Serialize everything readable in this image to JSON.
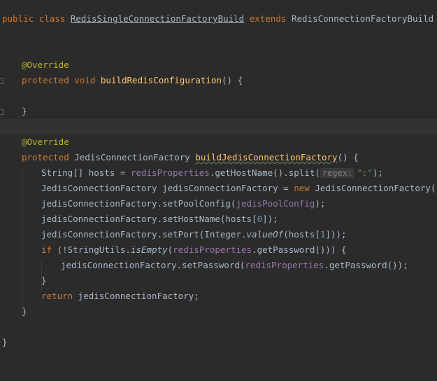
{
  "code": {
    "l1": {
      "kw1": "public",
      "kw2": "class",
      "cls": "RedisSingleConnectionFactoryBuild",
      "kw3": "extends",
      "parent": "RedisConnectionFactoryBuild",
      "brace": "{"
    },
    "l4": {
      "ann": "@Override"
    },
    "l5": {
      "kw1": "protected",
      "kw2": "void",
      "fn": "buildRedisConfiguration",
      "rest": "() {"
    },
    "l7": {
      "brace": "}"
    },
    "l9": {
      "ann": "@Override"
    },
    "l10": {
      "kw1": "protected",
      "type": "JedisConnectionFactory",
      "fn": "buildJedisConnectionFactory",
      "rest": "() {"
    },
    "l11": {
      "a": "String[] hosts = ",
      "field": "redisProperties",
      "b": ".getHostName().split(",
      "hint": "regex:",
      "str": "\":\"",
      "c": ");"
    },
    "l12": {
      "a": "JedisConnectionFactory jedisConnectionFactory = ",
      "kw": "new",
      "b": " JedisConnectionFactory();"
    },
    "l13": {
      "a": "jedisConnectionFactory.setPoolConfig(",
      "field": "jedisPoolConfig",
      "b": ");"
    },
    "l14": {
      "a": "jedisConnectionFactory.setHostName(hosts[",
      "num": "0",
      "b": "]);"
    },
    "l15": {
      "a": "jedisConnectionFactory.setPort(Integer.",
      "it": "valueOf",
      "b": "(hosts[",
      "num": "1",
      "c": "]));"
    },
    "l16": {
      "kw": "if",
      "a": " (!StringUtils.",
      "it": "isEmpty",
      "b": "(",
      "field": "redisProperties",
      "c": ".getPassword())) {"
    },
    "l17": {
      "a": "jedisConnectionFactory.setPassword(",
      "field": "redisProperties",
      "b": ".getPassword());"
    },
    "l18": {
      "brace": "}"
    },
    "l19": {
      "kw": "return",
      "a": " jedisConnectionFactory;"
    },
    "l20": {
      "brace": "}"
    },
    "l22": {
      "brace": "}"
    }
  }
}
